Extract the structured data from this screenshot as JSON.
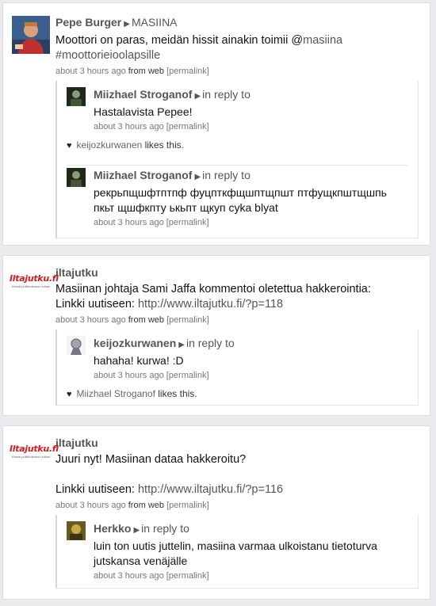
{
  "posts": [
    {
      "author": "Pepe Burger",
      "target": "MASIINA",
      "text_line1": "Moottori on paras, meidän hissit ainakin toimii @",
      "mention": "masiina",
      "text_line2": "#moottorieioolapsille",
      "time": "about 3 hours ago",
      "from": "from",
      "source": "web",
      "permalink": "[permalink]",
      "replies": [
        {
          "author": "Miizhael Stroganof",
          "in_reply_to": "in reply to",
          "text": "Hastalavista Pepee!",
          "time": "about 3 hours ago",
          "permalink": "[permalink]",
          "likes": {
            "user": "keijozkurwanen",
            "suffix": "likes this."
          }
        },
        {
          "author": "Miizhael Stroganof",
          "in_reply_to": "in reply to",
          "text_line1": "рекрьпщшфтптпф фуцпткфщшптщпшт птфущкпштщшпь",
          "text_line2": "пкьт щшфкпту ькьпт щкуп cyka blyat",
          "time": "about 3 hours ago",
          "permalink": "[permalink]"
        }
      ]
    },
    {
      "author": "iltajutku",
      "logo_text": "Iltajutku.fi",
      "logo_tag": "Kärsiä politiikoitanut uutiset",
      "text_line1": "Masiinan johtaja Sami Jaffa kommentoi oletettua hakkerointia:",
      "text_line2_prefix": "Linkki uutiseen: ",
      "link": "http://www.iltajutku.fi/?p=118",
      "time": "about 3 hours ago",
      "from": "from",
      "source": "web",
      "permalink": "[permalink]",
      "replies": [
        {
          "author": "keijozkurwanen",
          "in_reply_to": "in reply to",
          "text": "hahaha! kurwa! :D",
          "time": "about 3 hours ago",
          "permalink": "[permalink]",
          "likes": {
            "user": "Miizhael Stroganof",
            "suffix": "likes this."
          }
        }
      ]
    },
    {
      "author": "iltajutku",
      "logo_text": "Iltajutku.fi",
      "logo_tag": "Kärsiä politiikoitanut uutiset",
      "text_line1": "Juuri nyt! Masiinan dataa hakkeroitu?",
      "text_line2_prefix": "Linkki uutiseen: ",
      "link": "http://www.iltajutku.fi/?p=116",
      "time": "about 3 hours ago",
      "from": "from",
      "source": "web",
      "permalink": "[permalink]",
      "replies": [
        {
          "author": "Herkko",
          "in_reply_to": "in reply to",
          "text_line1": "luin ton uutis juttelin, masiina varmaa ulkoistanu tietoturva",
          "text_line2": "jutskansa venäjälle",
          "time": "about 3 hours ago",
          "permalink": "[permalink]"
        }
      ]
    }
  ]
}
